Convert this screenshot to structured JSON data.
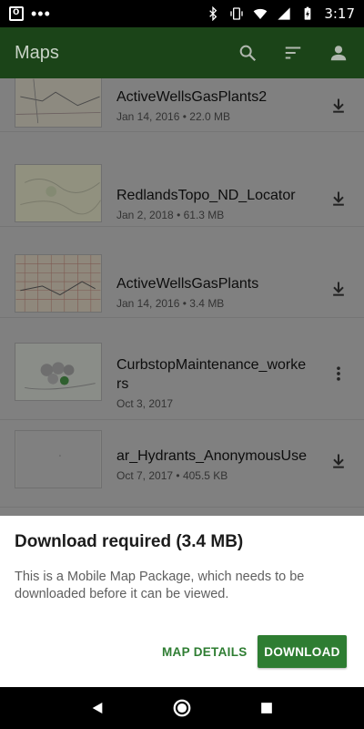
{
  "status_bar": {
    "time": "3:17",
    "left_icons": [
      "outlook-icon",
      "more-notifications-icon"
    ],
    "right_icons": [
      "bluetooth-icon",
      "vibrate-icon",
      "wifi-icon",
      "signal-icon",
      "battery-charging-icon"
    ]
  },
  "app_bar": {
    "title": "Maps",
    "actions": [
      "search-icon",
      "sort-icon",
      "account-icon"
    ]
  },
  "maps": [
    {
      "title": "ActiveWellsGasPlants2",
      "date": "Jan 14, 2016",
      "size": "22.0 MB",
      "action": "download-icon"
    },
    {
      "title": "RedlandsTopo_ND_Locator",
      "date": "Jan 2, 2018",
      "size": "61.3 MB",
      "action": "download-icon"
    },
    {
      "title": "ActiveWellsGasPlants",
      "date": "Jan 14, 2016",
      "size": "3.4 MB",
      "action": "download-icon"
    },
    {
      "title": "CurbstopMaintenance_workers",
      "date": "Oct 3, 2017",
      "size": "",
      "action": "more-vert-icon"
    },
    {
      "title": "ar_Hydrants_AnonymousUse",
      "date": "Oct 7, 2017",
      "size": "405.5 KB",
      "action": "download-icon"
    }
  ],
  "meta_separator": "•",
  "dialog": {
    "title": "Download required (3.4 MB)",
    "body": "This is a Mobile Map Package, which needs to be downloaded before it can be viewed.",
    "secondary_button": "MAP DETAILS",
    "primary_button": "DOWNLOAD"
  },
  "colors": {
    "app_bar": "#1b4418",
    "accent": "#2e7d32",
    "scrim": "#808080"
  },
  "nav_bar": {
    "buttons": [
      "back-icon",
      "home-icon",
      "recents-icon"
    ]
  }
}
